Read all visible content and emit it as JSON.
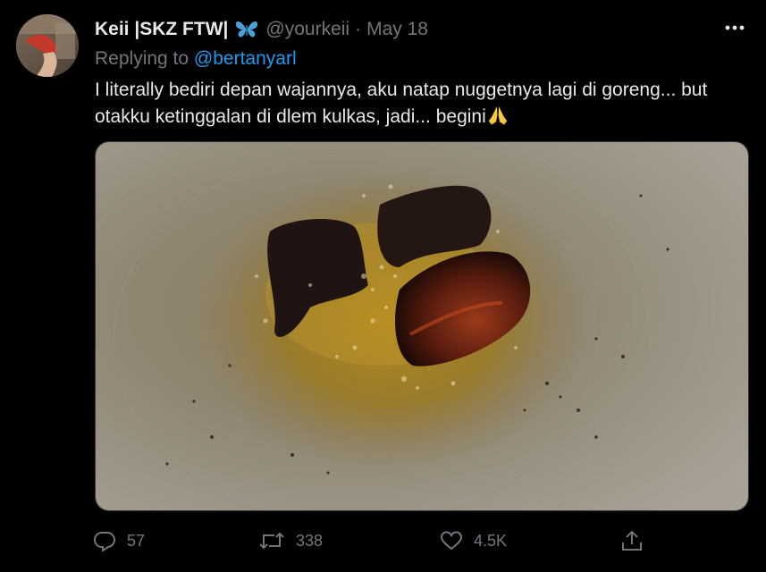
{
  "tweet": {
    "author": {
      "display_name": "Keii |SKZ FTW|",
      "badge_icon": "butterfly-emoji-icon",
      "handle": "@yourkeii"
    },
    "separator": "·",
    "date": "May 18",
    "more_icon": "more-horizontal-icon",
    "replying_to": {
      "prefix": "Replying to",
      "mention": "@bertanyarl"
    },
    "text_line_1": "I literally bediri depan wajannya, aku natap nuggetnya lagi di goreng... but",
    "text_line_2": "otakku ketinggalan di dlem kulkas, jadi... begini",
    "text_emoji": "folded-hands-emoji-icon",
    "media": {
      "icon": "photo-burnt-nuggets-in-wok"
    },
    "actions": {
      "reply": {
        "icon": "reply-icon",
        "count": "57"
      },
      "retweet": {
        "icon": "retweet-icon",
        "count": "338"
      },
      "like": {
        "icon": "like-heart-icon",
        "count": "4.5K"
      },
      "share": {
        "icon": "share-icon"
      }
    },
    "colors": {
      "background": "#000000",
      "text_primary": "#e7e9ea",
      "text_secondary": "#71767b",
      "link": "#1d9bf0"
    }
  }
}
